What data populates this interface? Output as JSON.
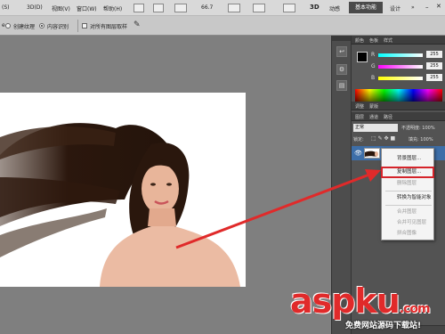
{
  "menubar": {
    "items": [
      "(S)",
      "3D(D)",
      "视图(V)",
      "窗口(W)",
      "帮助(H)"
    ],
    "zoom": "66.7",
    "workspace_3d": "3D",
    "workspace_motion": "动感",
    "workspace_essentials": "基本功能",
    "workspace_design": "设计"
  },
  "options": {
    "radio_texture": "创建纹理",
    "radio_content_aware": "内容识别",
    "sample_all_layers": "对所有图层取样"
  },
  "color_panel": {
    "tabs": [
      "颜色",
      "色板",
      "样式"
    ],
    "r_label": "R",
    "g_label": "G",
    "b_label": "B",
    "r_value": "255",
    "g_value": "255",
    "b_value": "255"
  },
  "adjust_tabs": [
    "调整",
    "蒙版"
  ],
  "layers_panel": {
    "tabs": [
      "图层",
      "通道",
      "路径"
    ],
    "blend_mode": "正常",
    "opacity": "不透明度: 100%",
    "lock_label": "锁定:",
    "fill_label": "填充: 100%",
    "layer_name": "背景"
  },
  "context_menu": {
    "items": [
      {
        "label": "背景图层..."
      },
      {
        "label": "复制图层..."
      },
      {
        "label": "删除图层"
      },
      {
        "label": "转换为智能对象"
      },
      {
        "label": "合并图层"
      },
      {
        "label": "合并可见图层"
      },
      {
        "label": "拼合图像"
      }
    ],
    "highlighted_index": 1
  },
  "watermark": {
    "brand": "aspku",
    "brand_suffix": ".com",
    "tagline": "免费网站源码下载站!"
  },
  "colors": {
    "accent_red": "#d5242a",
    "arrow_red": "#e02a2a",
    "panel_bg": "#535353",
    "canvas_bg": "#7f7f7f"
  }
}
